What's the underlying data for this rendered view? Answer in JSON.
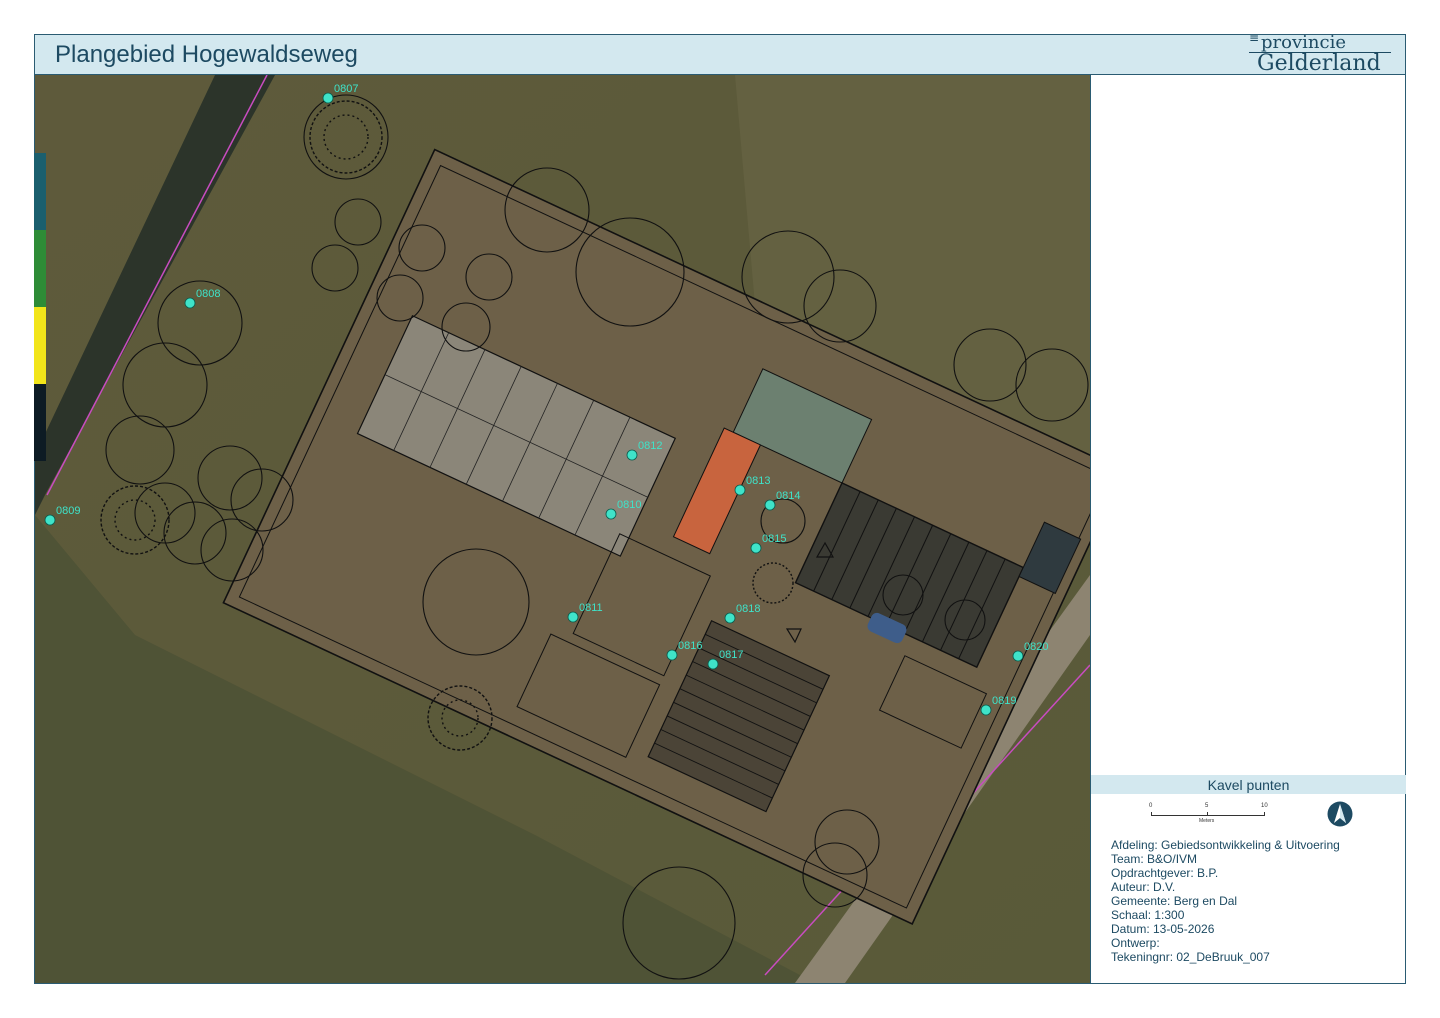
{
  "header": {
    "title": "Plangebied Hogewaldseweg"
  },
  "logo": {
    "line1": "provincie",
    "line2": "Gelderland"
  },
  "map": {
    "point_labels": [
      "0807",
      "0808",
      "0809",
      "0810",
      "0811",
      "0812",
      "0813",
      "0814",
      "0815",
      "0816",
      "0817",
      "0818",
      "0819",
      "0820"
    ]
  },
  "legend": {
    "heading": "Kavel punten",
    "scale": {
      "ticks": [
        "0",
        "5",
        "10"
      ],
      "unit": "Meters"
    },
    "north_icon": "north-arrow-icon"
  },
  "colorbar": [
    "#1b5f6e",
    "#2e8c36",
    "#f2e51a",
    "#0d1b24"
  ],
  "info": [
    "Afdeling:  Gebiedsontwikkeling & Uitvoering",
    "Team: B&O/IVM",
    "Opdrachtgever: B.P.",
    "Auteur: D.V.",
    "Gemeente:  Berg en Dal",
    "Schaal: 1:300",
    "Datum: 13-05-2026",
    "Ontwerp:",
    "Tekeningnr: 02_DeBruuk_007"
  ]
}
